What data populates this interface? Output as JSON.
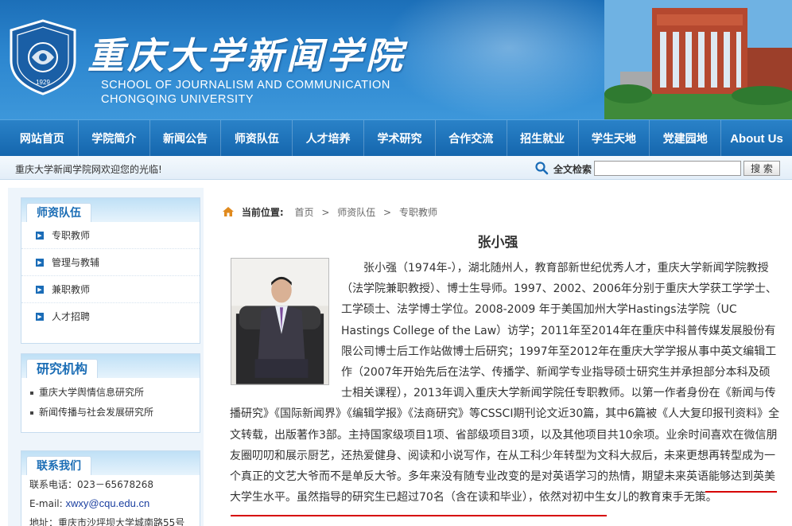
{
  "header": {
    "title": "重庆大学新闻学院",
    "subtitle_line1": "SCHOOL OF JOURNALISM AND COMMUNICATION",
    "subtitle_line2": "CHONGQING UNIVERSITY",
    "logo_year": "1929"
  },
  "nav": {
    "items": [
      "网站首页",
      "学院简介",
      "新闻公告",
      "师资队伍",
      "人才培养",
      "学术研究",
      "合作交流",
      "招生就业",
      "学生天地",
      "党建园地",
      "About Us"
    ]
  },
  "welcome": {
    "message": "重庆大学新闻学院网欢迎您的光临!",
    "search_label": "全文检索",
    "search_value": "",
    "search_button": "搜 索"
  },
  "sidebar": {
    "faculty": {
      "title": "师资队伍",
      "items": [
        "专职教师",
        "管理与教辅",
        "兼职教师",
        "人才招聘"
      ]
    },
    "research": {
      "title": "研究机构",
      "items": [
        "重庆大学舆情信息研究所",
        "新闻传播与社会发展研究所"
      ]
    },
    "contact": {
      "title": "联系我们",
      "phone": "联系电话：023－65678268",
      "email_label": "E-mail:",
      "email": "xwxy@cqu.edu.cn",
      "address": "地址：重庆市沙坪坝大学城南路55号"
    }
  },
  "breadcrumb": {
    "label": "当前位置:",
    "items": [
      "首页",
      "师资队伍",
      "专职教师"
    ],
    "separator": ">"
  },
  "profile": {
    "name": "张小强",
    "bio_part1": "张小强（1974年-），湖北随州人，教育部新世纪优秀人才，重庆大学新闻学院教授（法学院兼职教授）、博士生导师。1997、2002、2006年分别于重庆大学获工学学士、工学硕士、法学博士学位。2008-2009 年于美国加州大学Hastings法学院（UC Hastings College of the Law）访学；2011年至2014年在重庆中科普传媒发展股份有限公司博士后工作站做博士后研究；1997年至2012年在重庆大学学报从事中英文编辑工作（2007年开始先后在法学、传播学、新闻学专业指导硕士研究生并承担部分本科及硕士相关课程），2013年调入重庆大学新闻学院任专职教师。以第一作者身份在《新闻与传播研究》《国际新闻界》《编辑学报》《法商研究》等CSSCI期刊论文近30篇，其中6篇被《人大复印报刊资料》全文转载，出版著作3部。主持国家级项目1项、省部级项目3项，以及其他项目共10余项。业余时间喜欢在微信朋友圈叨叨和展示厨艺，还热爱健身、阅读和小说写作，在从工科少年转型为文科大叔后，未来更想再转型成为一个真正的文艺大爷而不是单反大爷。多年来没有随专业改变的是对英语学习的热情，期望未来英语能够达到英美大学生水平。",
    "bio_part2": "虽然指导的研究生已超过70名（含在读和毕业），依然对初中生女儿的教育束手无策。"
  },
  "colors": {
    "header_blue": "#1c6fb8",
    "nav_blue": "#1566ad",
    "accent_text": "#1b6db5",
    "underline_red": "#d60000"
  }
}
